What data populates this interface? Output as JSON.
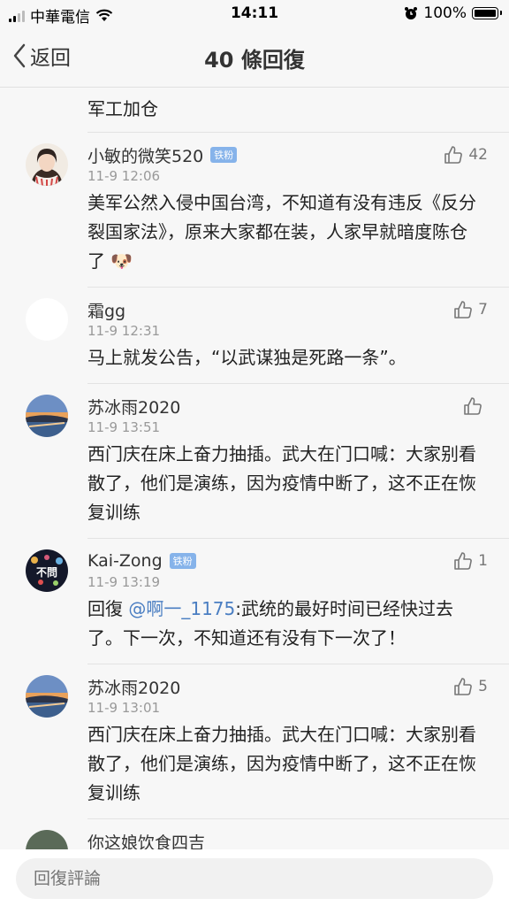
{
  "status_bar": {
    "carrier": "中華電信",
    "time": "14:11",
    "battery": "100%"
  },
  "nav": {
    "back_label": "返回",
    "title": "40 條回復"
  },
  "truncated_comment_text": "军工加仓",
  "comments": [
    {
      "username": "小敏的微笑520",
      "badge": "铁粉",
      "time": "11-9 12:06",
      "likes": "42",
      "text": "美军公然入侵中国台湾，不知道有没有违反《反分裂国家法》，原来大家都在装，人家早就暗度陈仓了",
      "emoji": "🐶"
    },
    {
      "username": "霜gg",
      "time": "11-9 12:31",
      "likes": "7",
      "text": "马上就发公告，“以武谋独是死路一条”。"
    },
    {
      "username": "苏冰雨2020",
      "time": "11-9 13:51",
      "likes": "",
      "text": "西门庆在床上奋力抽插。武大在门口喊：大家别看散了，他们是演练，因为疫情中断了，这不正在恢复训练"
    },
    {
      "username": "Kai-Zong",
      "badge": "铁粉",
      "avatar_text": "不問",
      "time": "11-9 13:19",
      "likes": "1",
      "reply_prefix": "回復",
      "mention": "@啊一_1175",
      "text": ":武统的最好时间已经快过去了。下一次，不知道还有没有下一次了！"
    },
    {
      "username": "苏冰雨2020",
      "time": "11-9 13:01",
      "likes": "5",
      "text": "西门庆在床上奋力抽插。武大在门口喊：大家别看散了，他们是演练，因为疫情中断了，这不正在恢复训练"
    },
    {
      "username": "你这娘饮食四吉"
    }
  ],
  "reply_box": {
    "placeholder": "回復評論"
  },
  "colors": {
    "background": "#f7f7f7",
    "mention": "#4a7ec2",
    "badge": "#86b3ea"
  },
  "icons": [
    "chevron-left-icon",
    "wifi-icon",
    "alarm-icon",
    "battery-icon",
    "thumbs-up-icon"
  ]
}
